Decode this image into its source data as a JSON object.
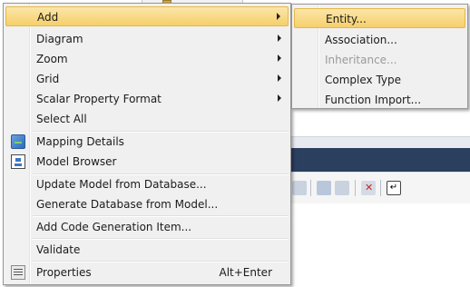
{
  "main_menu": {
    "items": [
      {
        "label": "Add",
        "has_submenu": true,
        "highlighted": true
      },
      {
        "label": "Diagram",
        "has_submenu": true
      },
      {
        "label": "Zoom",
        "has_submenu": true
      },
      {
        "label": "Grid",
        "has_submenu": true
      },
      {
        "label": "Scalar Property Format",
        "has_submenu": true
      },
      {
        "label": "Select All"
      },
      {
        "label": "Mapping Details",
        "icon": "mapping-details-icon"
      },
      {
        "label": "Model Browser",
        "icon": "model-browser-icon"
      },
      {
        "label": "Update Model from Database..."
      },
      {
        "label": "Generate Database from Model..."
      },
      {
        "label": "Add Code Generation Item..."
      },
      {
        "label": "Validate"
      },
      {
        "label": "Properties",
        "icon": "properties-icon",
        "shortcut": "Alt+Enter"
      }
    ]
  },
  "sub_menu": {
    "items": [
      {
        "label": "Entity...",
        "highlighted": true
      },
      {
        "label": "Association..."
      },
      {
        "label": "Inheritance...",
        "disabled": true
      },
      {
        "label": "Complex Type"
      },
      {
        "label": "Function Import..."
      }
    ]
  },
  "colors": {
    "highlight_top": "#fbe6a9",
    "highlight_bottom": "#f6cf6a",
    "menu_background": "#f0f0f0",
    "disabled_text": "#9a9a9a",
    "background_band": "#2b3f5f"
  }
}
